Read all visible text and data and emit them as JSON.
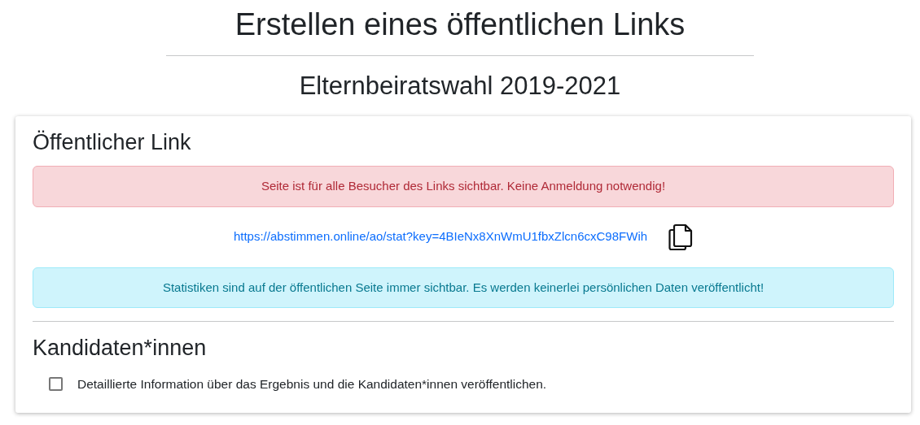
{
  "title": "Erstellen eines öffentlichen Links",
  "subtitle": "Elternbeiratswahl 2019-2021",
  "card": {
    "heading": "Öffentlicher Link",
    "warning": "Seite ist für alle Besucher des Links sichtbar. Keine Anmeldung notwendig!",
    "link": "https://abstimmen.online/ao/stat?key=4BIeNx8XnWmU1fbxZlcn6cxC98FWih",
    "info": "Statistiken sind auf der öffentlichen Seite immer sichtbar. Es werden keinerlei persönlichen Daten veröffentlicht!",
    "section_heading": "Kandidaten*innen",
    "option": {
      "label": "Detaillierte Information über das Ergebnis und die Kandidaten*innen veröffentlichen.",
      "checked": false
    }
  }
}
